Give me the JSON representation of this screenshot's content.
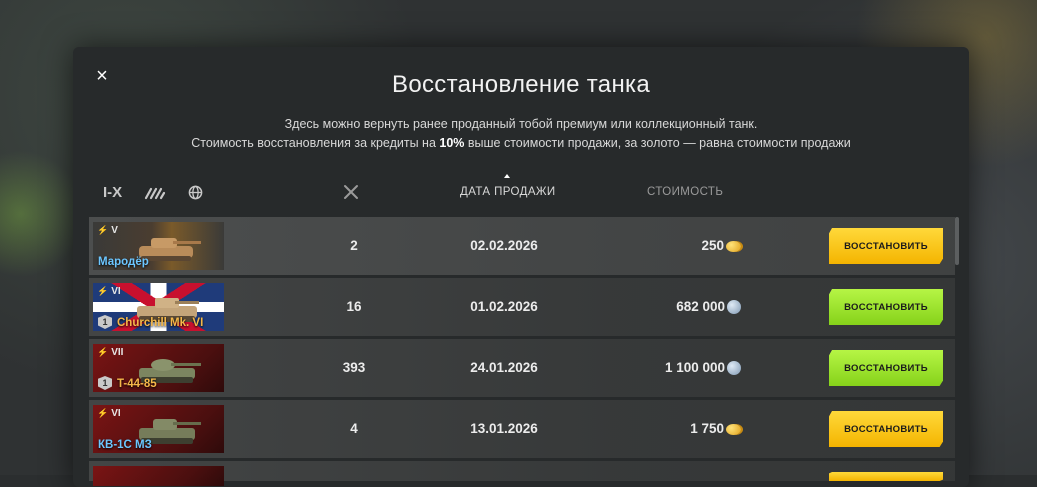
{
  "modal": {
    "title": "Восстановление танка",
    "subtitle_line1": "Здесь можно вернуть ранее проданный тобой премиум или коллекционный танк.",
    "subtitle_line2_pre": "Стоимость восстановления за кредиты на ",
    "subtitle_line2_bold": "10%",
    "subtitle_line2_post": " выше стоимости продажи, за золото — равна стоимости продажи",
    "close_label": "×"
  },
  "filters": {
    "tier_label": "I-X"
  },
  "columns": {
    "date": "ДАТА ПРОДАЖИ",
    "cost": "СТОИМОСТЬ"
  },
  "rows": [
    {
      "tier": "V",
      "name": "Мародёр",
      "rank": "",
      "battles": "2",
      "date": "02.02.2026",
      "cost": "250",
      "currency": "gold",
      "button": "ВОССТАНОВИТЬ",
      "btn_style": "gold"
    },
    {
      "tier": "VI",
      "name": "Churchill Mk. VI",
      "rank": "1",
      "battles": "16",
      "date": "01.02.2026",
      "cost": "682 000",
      "currency": "silver",
      "button": "ВОССТАНОВИТЬ",
      "btn_style": "green"
    },
    {
      "tier": "VII",
      "name": "T-44-85",
      "rank": "1",
      "battles": "393",
      "date": "24.01.2026",
      "cost": "1 100 000",
      "currency": "silver",
      "button": "ВОССТАНОВИТЬ",
      "btn_style": "green"
    },
    {
      "tier": "VI",
      "name": "КВ-1С МЗ",
      "rank": "",
      "battles": "4",
      "date": "13.01.2026",
      "cost": "1 750",
      "currency": "gold",
      "button": "ВОССТАНОВИТЬ",
      "btn_style": "gold"
    }
  ]
}
